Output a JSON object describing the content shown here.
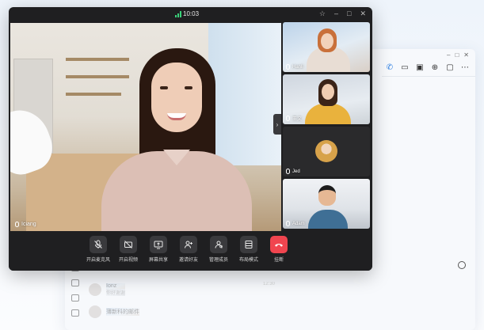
{
  "meeting": {
    "time": "10:03",
    "main_speaker": "Iciang",
    "participants": [
      {
        "name": "Hanli"
      },
      {
        "name": "王文"
      },
      {
        "name": "Jed"
      },
      {
        "name": "Adam"
      }
    ],
    "controls": [
      {
        "label": "开启麦克风",
        "icon": "mic-off-icon"
      },
      {
        "label": "开启视频",
        "icon": "camera-off-icon"
      },
      {
        "label": "屏幕共享",
        "icon": "screen-share-icon"
      },
      {
        "label": "邀请好友",
        "icon": "add-person-icon"
      },
      {
        "label": "管理成员",
        "icon": "members-icon"
      },
      {
        "label": "布局模式",
        "icon": "layout-icon"
      },
      {
        "label": "挂断",
        "icon": "hang-up-icon"
      }
    ],
    "colors": {
      "end_call": "#f0454f",
      "signal": "#3ad17a"
    }
  },
  "background_chat": {
    "contacts": [
      {
        "name": "Ionz",
        "preview": "你好谢谢",
        "time": ""
      },
      {
        "name": "薄新科的邮件",
        "preview": "",
        "time": "12:30"
      }
    ]
  }
}
